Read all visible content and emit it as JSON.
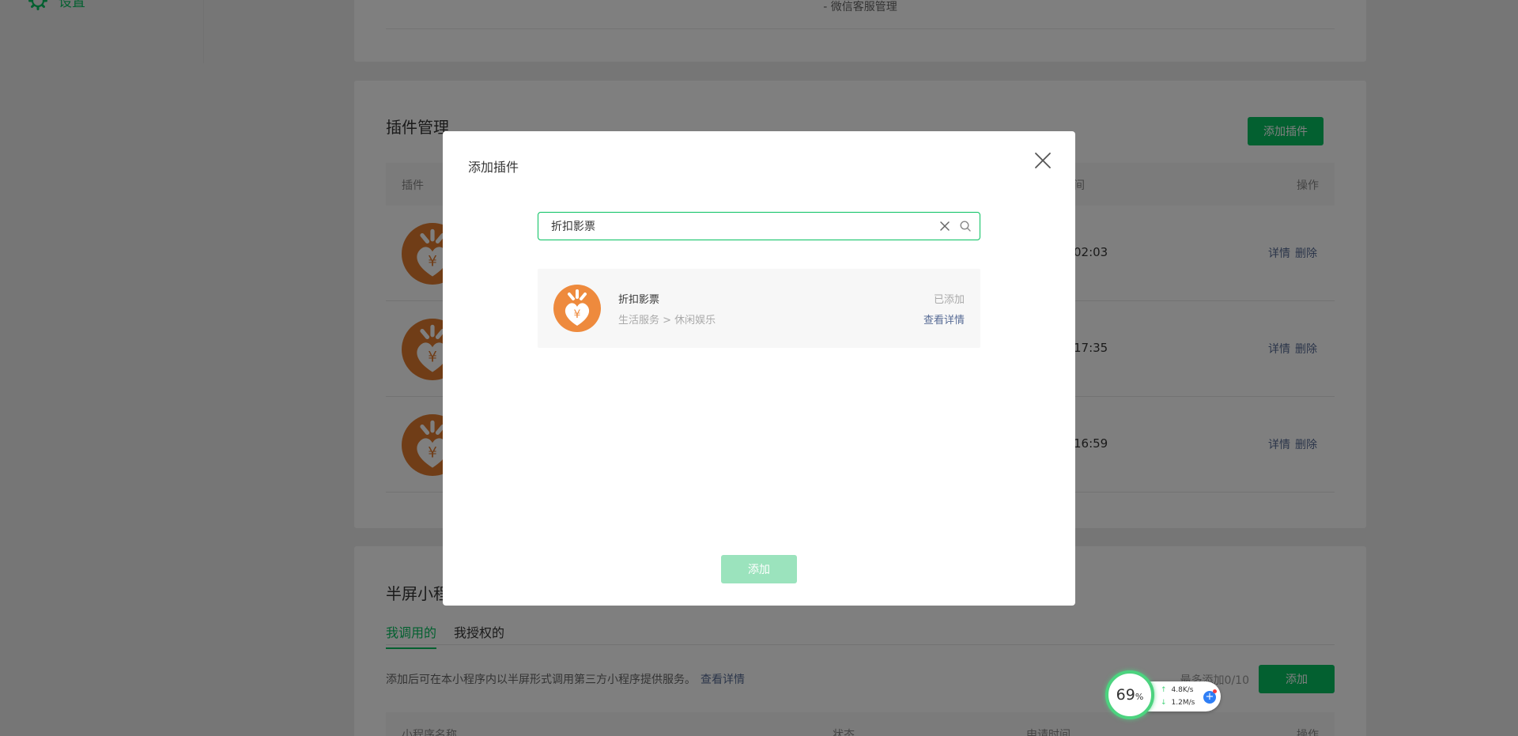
{
  "sidebar": {
    "settings_label": "设置"
  },
  "service_card": {
    "note": "- 微信客服管理"
  },
  "plugin_card": {
    "title": "插件管理",
    "add_button": "添加插件",
    "columns": [
      "插件",
      "间",
      "操作"
    ],
    "rows": [
      {
        "time": "02:03",
        "detail": "详情",
        "delete": "删除"
      },
      {
        "time": "17:35",
        "detail": "详情",
        "delete": "删除"
      },
      {
        "time": "16:59",
        "detail": "详情",
        "delete": "删除"
      }
    ]
  },
  "half_screen_card": {
    "title": "半屏小程",
    "tabs": [
      "我调用的",
      "我授权的"
    ],
    "description": "添加后可在本小程序内以半屏形式调用第三方小程序提供服务。",
    "description_link": "查看详情",
    "limit": "最多添加0/10",
    "add_button": "添加",
    "columns": [
      "小程序名称",
      "状态",
      "申请时间",
      "操作"
    ]
  },
  "dialog": {
    "title": "添加插件",
    "search_value": "折扣影票",
    "result": {
      "name": "折扣影票",
      "category": "生活服务 > 休闲娱乐",
      "status": "已添加",
      "detail_link": "查看详情"
    },
    "add_button": "添加"
  },
  "speed_widget": {
    "percent": "69",
    "percent_unit": "%",
    "upload": "4.8K/s",
    "download": "1.2M/s",
    "plus": "+"
  },
  "colors": {
    "brand_green": "#07c160",
    "link_blue": "#576b95",
    "plugin_orange": "#e07a2e"
  }
}
